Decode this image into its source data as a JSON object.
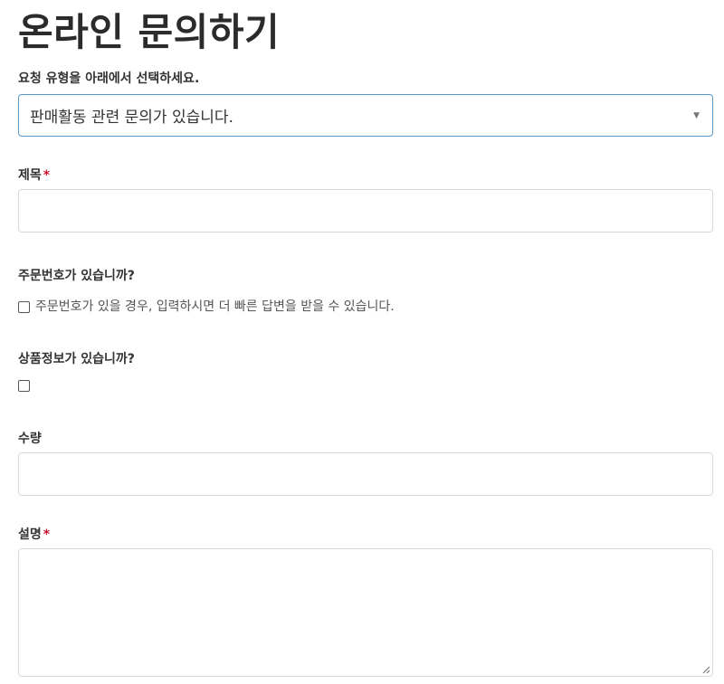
{
  "title": "온라인 문의하기",
  "request_type": {
    "label": "요청 유형을 아래에서 선택하세요.",
    "selected": "판매활동 관련 문의가 있습니다.",
    "caret": "▼"
  },
  "subject": {
    "label": "제목",
    "required_mark": "*",
    "value": ""
  },
  "order_number": {
    "label": "주문번호가 있습니까?",
    "checkbox_label": "주문번호가 있을 경우, 입력하시면 더 빠른 답변을 받을 수 있습니다.",
    "checked": false
  },
  "product_info": {
    "label": "상품정보가 있습니까?",
    "checked": false
  },
  "quantity": {
    "label": "수량",
    "value": ""
  },
  "description": {
    "label": "설명",
    "required_mark": "*",
    "value": ""
  },
  "colors": {
    "required": "#c8102e",
    "select_border": "#5b9bc8",
    "input_border": "#d9d9d9"
  }
}
